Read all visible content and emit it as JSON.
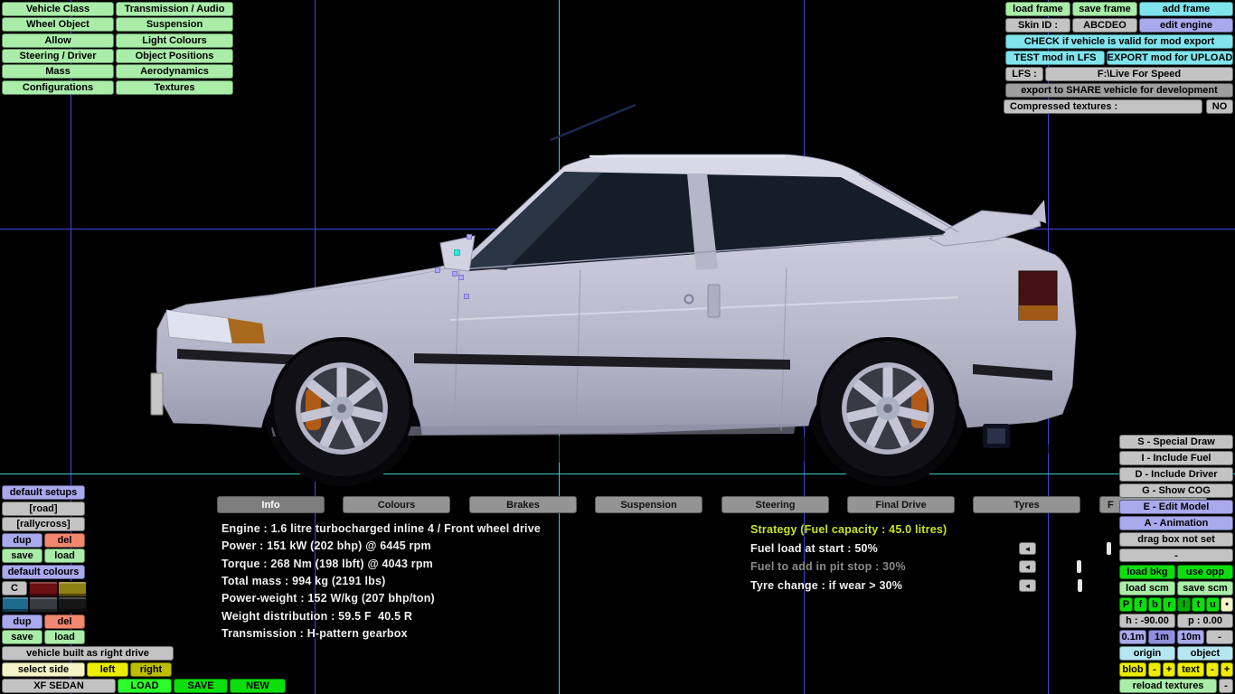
{
  "menu": {
    "col1": [
      "Vehicle Class",
      "Wheel Object",
      "Allow",
      "Steering / Driver",
      "Mass",
      "Configurations"
    ],
    "col2": [
      "Transmission / Audio",
      "Suspension",
      "Light Colours",
      "Object Positions",
      "Aerodynamics",
      "Textures"
    ]
  },
  "frame_bar": {
    "load": "load frame",
    "save": "save frame",
    "add": "add frame"
  },
  "skin": {
    "label": "Skin ID :",
    "value": "ABCDEO",
    "edit_engine": "edit engine"
  },
  "export": {
    "check": "CHECK if vehicle is valid for mod export",
    "test": "TEST mod in LFS",
    "upload": "EXPORT mod for UPLOAD",
    "lfs_label": "LFS :",
    "lfs_path": "F:\\Live For Speed",
    "share": "export to SHARE vehicle for development",
    "compressed_label": "Compressed textures :",
    "compressed_value": "NO"
  },
  "tabs": {
    "info": "Info",
    "colours": "Colours",
    "brakes": "Brakes",
    "suspension": "Suspension",
    "steering": "Steering",
    "final_drive": "Final Drive",
    "tyres": "Tyres",
    "clipped": "F"
  },
  "info_panel": {
    "lines": [
      "Engine : 1.6 litre turbocharged inline 4 / Front wheel drive",
      "Power : 151 kW (202 bhp) @ 6445 rpm",
      "Torque : 268 Nm (198 lbft) @ 4043 rpm",
      "Total mass : 994 kg (2191 lbs)",
      "Power-weight : 152 W/kg (207 bhp/ton)",
      "Weight distribution : 59.5 F  40.5 R",
      "Transmission : H-pattern gearbox"
    ]
  },
  "strategy": {
    "title": "Strategy (Fuel capacity : 45.0 litres)",
    "row1": "Fuel load at start : 50%",
    "row2": "Fuel to add in pit stop : 30%",
    "row3": "Tyre change : if wear > 30%",
    "arrow": "◄"
  },
  "setups": {
    "title": "default setups",
    "road": "[road]",
    "rallycross": "[rallycross]",
    "dup": "dup",
    "del": "del",
    "save": "save",
    "load": "load"
  },
  "colours_panel": {
    "title": "default colours",
    "c": "C",
    "dup": "dup",
    "del": "del",
    "save": "save",
    "load": "load",
    "swatches": [
      "#6b1014",
      "#8d8014",
      "#1c6a8c",
      "#3a3a42",
      "#161616"
    ]
  },
  "drive": {
    "built": "vehicle built as right drive",
    "select_side": "select side",
    "left": "left",
    "right": "right"
  },
  "vehicle_bar": {
    "name": "XF SEDAN",
    "load": "LOAD",
    "save": "SAVE",
    "new": "NEW"
  },
  "view_panel": {
    "special_draw": "S - Special Draw",
    "include_fuel": "I - Include Fuel",
    "include_driver": "D - Include Driver",
    "show_cog": "G - Show COG",
    "edit_model": "E - Edit Model",
    "animation": "A - Animation",
    "drag_box": "drag box not set",
    "dash": "-"
  },
  "tools": {
    "load_bkg": "load bkg",
    "use_opp": "use opp",
    "load_scm": "load scm",
    "save_scm": "save scm",
    "letters": [
      "P",
      "f",
      "b",
      "r",
      "l",
      "t",
      "u"
    ],
    "dot": "•",
    "heading": "h : -90.00",
    "pitch": "p : 0.00",
    "scale_01": "0.1m",
    "scale_1": "1m",
    "scale_10": "10m",
    "dash": "-",
    "origin": "origin",
    "object": "object",
    "blob": "blob",
    "minus": "-",
    "plus": "+",
    "text": "text",
    "reload": "reload textures"
  },
  "colors": {
    "grid_blue": "#4646dc",
    "grid_cyan": "#3ecaca",
    "accent_green": "#0bdf0b",
    "pale_green": "#a9eda9",
    "periwinkle": "#a9a9ee",
    "cyan_button": "#7fe4ec",
    "salmon": "#f2876f",
    "yellow": "#ededed00",
    "strategy_text": "#c9e418",
    "car_body": "#c4c4d6"
  }
}
